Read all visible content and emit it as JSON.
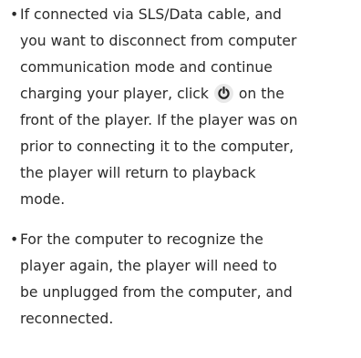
{
  "document": {
    "bullet_symbol": "•",
    "item1": {
      "lines": [
        "If connected via SLS/Data cable, and",
        "you want to disconnect from computer",
        "communication mode and continue",
        "charging your player, click",
        "on the",
        "front of the player. If the player was on",
        "prior to connecting it to the computer,",
        "the player will return to playback",
        "mode."
      ],
      "icon": "power-icon"
    },
    "item2": {
      "lines": [
        "For the computer to recognize the",
        "player again, the player will need to",
        "be unplugged from the computer, and",
        "reconnected."
      ]
    }
  }
}
